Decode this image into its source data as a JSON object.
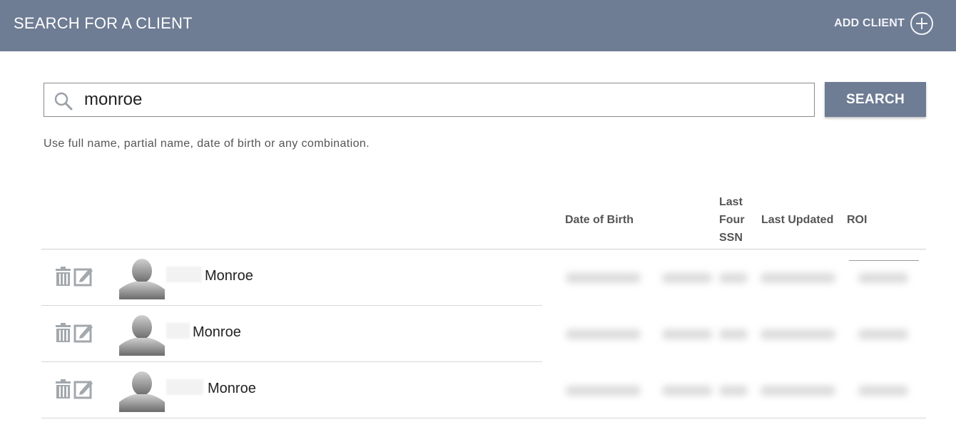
{
  "header": {
    "title": "SEARCH FOR A CLIENT",
    "add_client_label": "ADD CLIENT",
    "add_client_icon": "plus-circle-icon"
  },
  "search": {
    "value": "monroe",
    "icon": "search-icon",
    "button_label": "SEARCH",
    "hint": "Use full name, partial name, date of birth or any combination."
  },
  "table": {
    "columns": {
      "dob": "Date of Birth",
      "ssn": "Last Four SSN",
      "updated": "Last Updated",
      "roi": "ROI"
    },
    "rows": [
      {
        "last_name": "Monroe"
      },
      {
        "last_name": "Monroe"
      },
      {
        "last_name": "Monroe"
      }
    ]
  },
  "colors": {
    "header_bg": "#6e7c94",
    "button_bg": "#6e7c94",
    "icon_gray": "#9aa0a6"
  }
}
